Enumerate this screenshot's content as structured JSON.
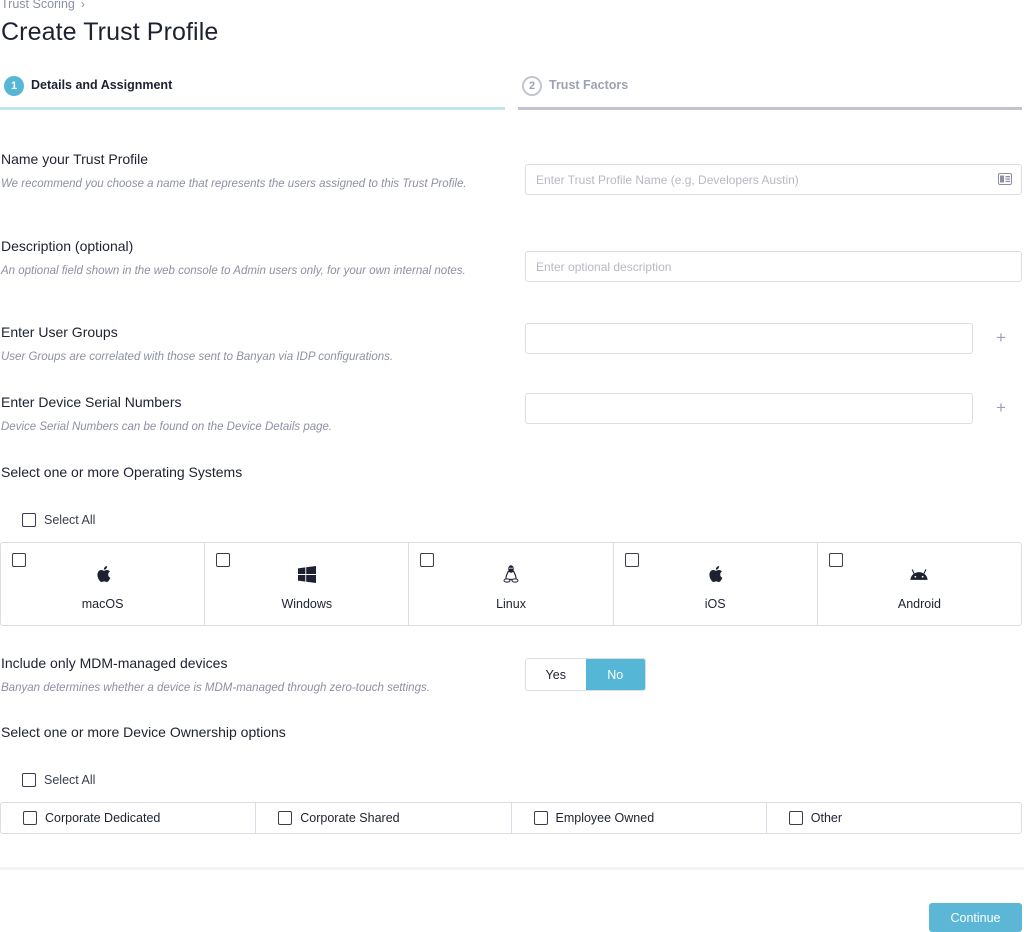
{
  "breadcrumb": {
    "parent": "Trust Scoring",
    "separator_icon": "chevron-right-icon"
  },
  "page_title": "Create Trust Profile",
  "steps": [
    {
      "number": "1",
      "label": "Details and Assignment",
      "state": "active"
    },
    {
      "number": "2",
      "label": "Trust Factors",
      "state": "inactive"
    }
  ],
  "fields": {
    "name": {
      "label": "Name your Trust Profile",
      "help": "We recommend you choose a name that represents the users assigned to this Trust Profile.",
      "value": "",
      "placeholder": "Enter Trust Profile Name (e.g, Developers Austin)",
      "icon": "contact-card-icon"
    },
    "description": {
      "label": "Description (optional)",
      "help": "An optional field shown in the web console to Admin users only, for your own internal notes.",
      "value": "",
      "placeholder": "Enter optional description"
    },
    "user_groups": {
      "label": "Enter User Groups",
      "help": "User Groups are correlated with those sent to Banyan via IDP configurations.",
      "value": "",
      "add_icon": "plus-icon"
    },
    "serial_numbers": {
      "label": "Enter Device Serial Numbers",
      "help": "Device Serial Numbers can be found on the Device Details page.",
      "value": "",
      "add_icon": "plus-icon"
    }
  },
  "operating_systems": {
    "title": "Select one or more Operating Systems",
    "select_all_label": "Select All",
    "select_all_checked": false,
    "options": [
      {
        "name": "macOS",
        "icon": "apple-icon",
        "checked": false
      },
      {
        "name": "Windows",
        "icon": "windows-icon",
        "checked": false
      },
      {
        "name": "Linux",
        "icon": "linux-tux-icon",
        "checked": false
      },
      {
        "name": "iOS",
        "icon": "apple-icon",
        "checked": false
      },
      {
        "name": "Android",
        "icon": "android-icon",
        "checked": false
      }
    ]
  },
  "mdm": {
    "label": "Include only MDM-managed devices",
    "help": "Banyan determines whether a device is MDM-managed through zero-touch settings.",
    "options": [
      "Yes",
      "No"
    ],
    "selected": "No"
  },
  "ownership": {
    "title": "Select one or more Device Ownership options",
    "select_all_label": "Select All",
    "select_all_checked": false,
    "options": [
      {
        "name": "Corporate Dedicated",
        "checked": false
      },
      {
        "name": "Corporate Shared",
        "checked": false
      },
      {
        "name": "Employee Owned",
        "checked": false
      },
      {
        "name": "Other",
        "checked": false
      }
    ]
  },
  "footer": {
    "continue_label": "Continue"
  },
  "colors": {
    "accent": "#56b6d6",
    "accent_light": "#bfe5ef",
    "inactive": "#c2c4d2",
    "text_primary": "#1e2132",
    "text_muted": "#8d90a5"
  }
}
